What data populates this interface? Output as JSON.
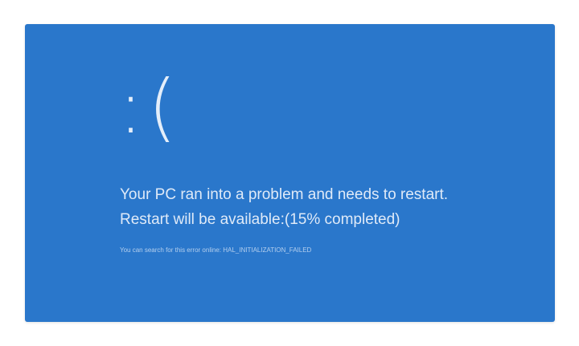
{
  "screen": {
    "background_color": "#2a77cb",
    "text_color": "#dfeaf8"
  },
  "sad_face": ":(",
  "message": {
    "line1": "Your PC ran into a problem and needs to restart.",
    "line2": "Restart will be available:(15% completed)"
  },
  "progress_percent": 15,
  "error_line": "You can search for this error online: HAL_INITIALIZATION_FAILED"
}
